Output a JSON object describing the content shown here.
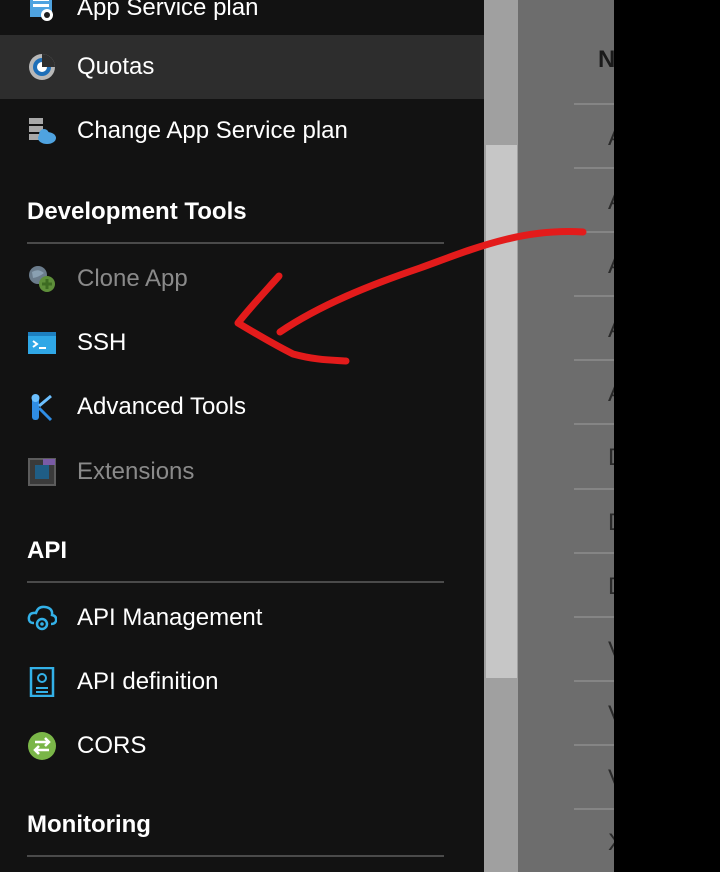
{
  "nav": {
    "items_top": [
      {
        "label": "App Service plan",
        "icon": "app-service-plan-icon"
      },
      {
        "label": "Quotas",
        "icon": "quotas-icon",
        "selected": true
      },
      {
        "label": "Change App Service plan",
        "icon": "change-plan-icon"
      }
    ],
    "sections": [
      {
        "header": "Development Tools",
        "items": [
          {
            "label": "Clone App",
            "icon": "clone-app-icon",
            "disabled": true
          },
          {
            "label": "SSH",
            "icon": "ssh-terminal-icon"
          },
          {
            "label": "Advanced Tools",
            "icon": "advanced-tools-icon"
          },
          {
            "label": "Extensions",
            "icon": "extensions-icon",
            "disabled": true
          }
        ]
      },
      {
        "header": "API",
        "items": [
          {
            "label": "API Management",
            "icon": "api-management-icon"
          },
          {
            "label": "API definition",
            "icon": "api-definition-icon"
          },
          {
            "label": "CORS",
            "icon": "cors-icon"
          }
        ]
      },
      {
        "header": "Monitoring",
        "items": []
      }
    ]
  },
  "right_panel": {
    "column_header": "N",
    "row_letters": [
      "A",
      "A",
      "A",
      "A",
      "A",
      "D",
      "D",
      "D",
      "V",
      "V",
      "V",
      "X"
    ]
  },
  "colors": {
    "nav_background": "#121212",
    "selected_background": "#2d2d2d",
    "disabled_text": "#8a8a8a",
    "annotation_arrow": "#e31b1b"
  }
}
